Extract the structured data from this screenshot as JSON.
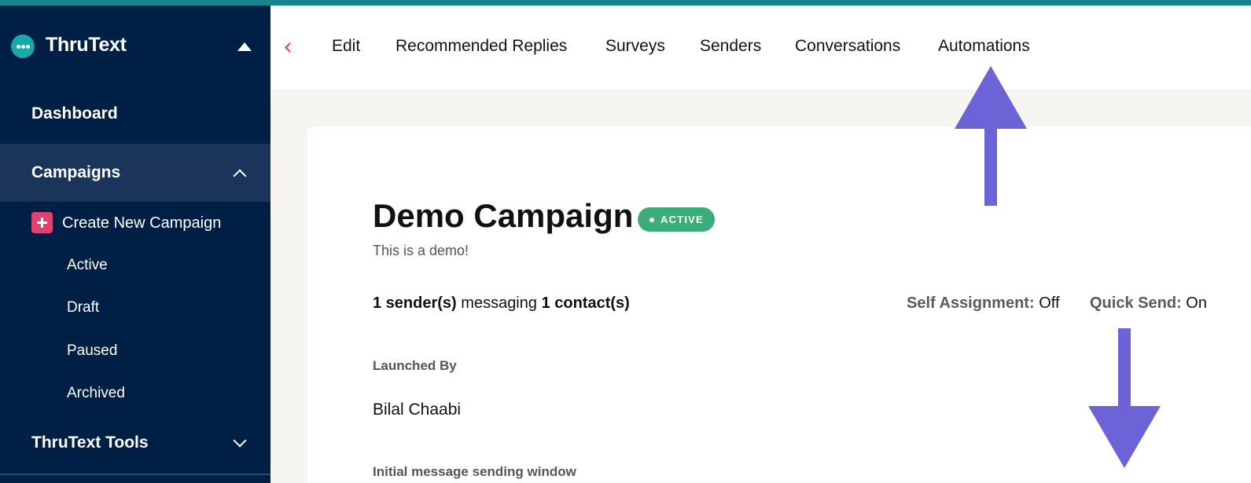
{
  "app": {
    "name": "ThruText"
  },
  "sidebar": {
    "dashboard": "Dashboard",
    "campaigns": "Campaigns",
    "create": "Create New Campaign",
    "sub_items": [
      "Active",
      "Draft",
      "Paused",
      "Archived"
    ],
    "tools": "ThruText Tools"
  },
  "tabs": [
    "Edit",
    "Recommended Replies",
    "Surveys",
    "Senders",
    "Conversations",
    "Automations"
  ],
  "campaign": {
    "title": "Demo Campaign",
    "status": "ACTIVE",
    "description": "This is a demo!",
    "senders": "1 sender(s)",
    "messaging": "messaging",
    "contacts": "1 contact(s)",
    "self_assignment_label": "Self Assignment:",
    "self_assignment_value": "Off",
    "quick_send_label": "Quick Send:",
    "quick_send_value": "On",
    "launched_by_label": "Launched By",
    "launched_by_value": "Bilal Chaabi",
    "window_label": "Initial message sending window"
  },
  "colors": {
    "sidebar_bg": "#001f45",
    "sidebar_active": "#1b3459",
    "accent_teal": "#15868a",
    "badge_green": "#3cac7a",
    "create_pink": "#e0426f",
    "annotation_arrow": "#6b63d6"
  }
}
